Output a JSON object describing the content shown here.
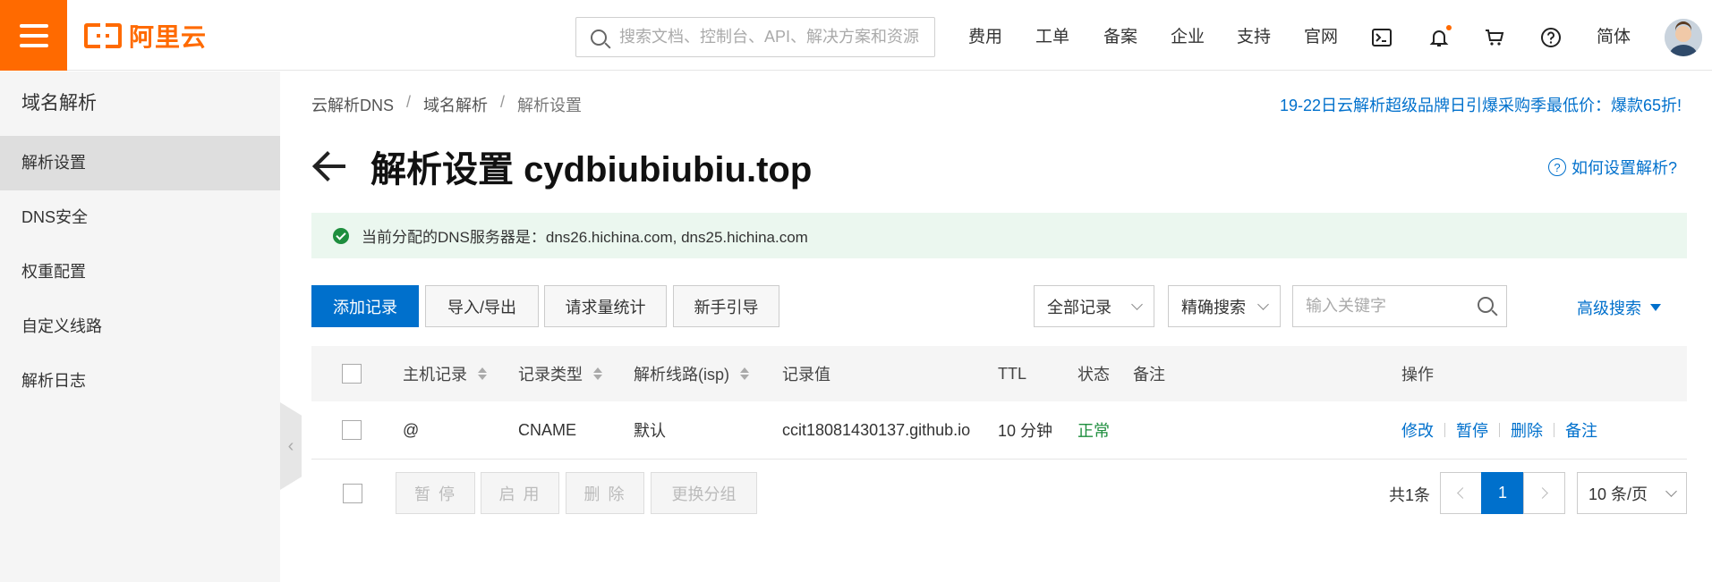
{
  "header": {
    "logo_text": "阿里云",
    "search_placeholder": "搜索文档、控制台、API、解决方案和资源",
    "nav": [
      "费用",
      "工单",
      "备案",
      "企业",
      "支持",
      "官网"
    ],
    "language": "简体",
    "accent_color": "#ff6a00"
  },
  "sidebar": {
    "title": "域名解析",
    "items": [
      {
        "label": "解析设置",
        "active": true
      },
      {
        "label": "DNS安全",
        "active": false
      },
      {
        "label": "权重配置",
        "active": false
      },
      {
        "label": "自定义线路",
        "active": false
      },
      {
        "label": "解析日志",
        "active": false
      }
    ]
  },
  "breadcrumb": [
    "云解析DNS",
    "域名解析",
    "解析设置"
  ],
  "promo": "19-22日云解析超级品牌日引爆采购季最低价：爆款65折!",
  "page": {
    "title": "解析设置 cydbiubiubiu.top",
    "help_link": "如何设置解析?",
    "dns_notice": "当前分配的DNS服务器是：dns26.hichina.com, dns25.hichina.com"
  },
  "toolbar": {
    "add": "添加记录",
    "import_export": "导入/导出",
    "stats": "请求量统计",
    "guide": "新手引导",
    "record_filter": "全部记录",
    "search_mode": "精确搜索",
    "keyword_placeholder": "输入关键字",
    "advanced": "高级搜索"
  },
  "table": {
    "columns": [
      "主机记录",
      "记录类型",
      "解析线路(isp)",
      "记录值",
      "TTL",
      "状态",
      "备注",
      "操作"
    ],
    "rows": [
      {
        "host": "@",
        "type": "CNAME",
        "line": "默认",
        "value": "ccit18081430137.github.io",
        "ttl": "10 分钟",
        "status": "正常",
        "remark": "",
        "ops": [
          "修改",
          "暂停",
          "删除",
          "备注"
        ]
      }
    ]
  },
  "footer": {
    "pause": "暂 停",
    "enable": "启 用",
    "delete": "删 除",
    "regroup": "更换分组",
    "total": "共1条",
    "current_page": "1",
    "page_size": "10 条/页"
  }
}
